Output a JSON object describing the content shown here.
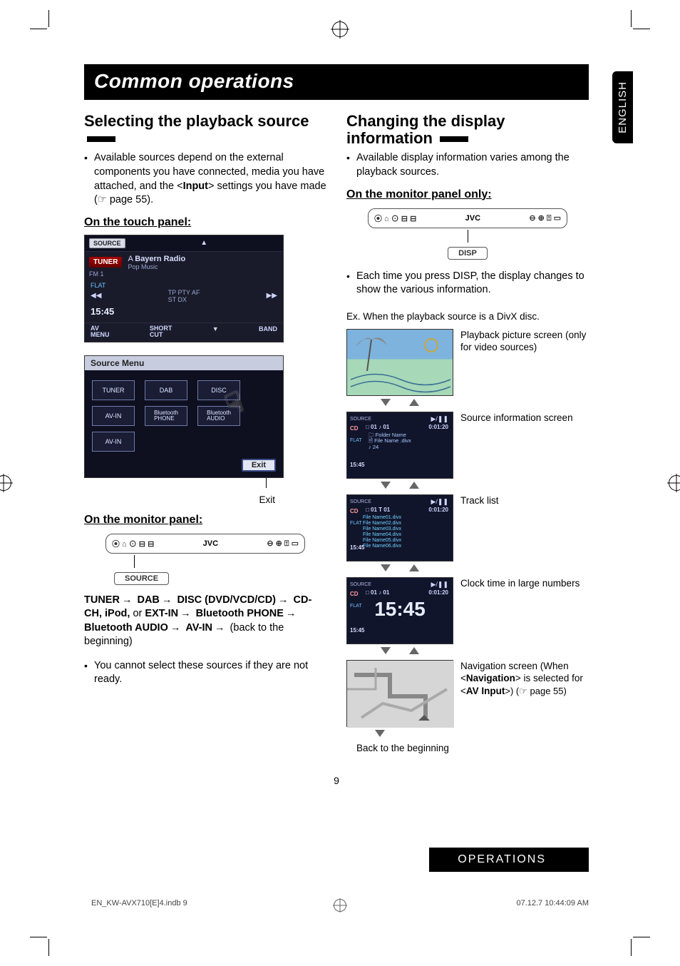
{
  "meta": {
    "language_tab": "ENGLISH",
    "page_number": "9",
    "footer_section": "OPERATIONS",
    "footer_file": "EN_KW-AVX710[E]4.indb   9",
    "footer_timestamp": "07.12.7   10:44:09 AM"
  },
  "title": "Common operations",
  "left": {
    "section_title": "Selecting the playback source",
    "bullet1_pre": "Available sources depend on the external components you have connected, media you have attached, and the <",
    "bullet1_bold": "Input",
    "bullet1_post": "> settings you have made (☞ page 55).",
    "sub_touch": "On the touch panel:",
    "screen": {
      "source_btn": "SOURCE",
      "tuner_badge": "TUNER",
      "fm_label": "FM 1",
      "station_prefix": "A ",
      "station_bold": "Bayern Radio",
      "station_sub": "Pop Music",
      "flat": "FLAT",
      "indicators": "TP PTY AF",
      "stdx": "ST  DX",
      "time": "15:45",
      "av_menu": "AV\nMENU",
      "short": "SHORT\nCUT",
      "band": "BAND",
      "prev_icon": "◀◀",
      "next_icon": "▶▶",
      "up_icon": "▲",
      "down_icon": "▼"
    },
    "source_menu": {
      "header": "Source Menu",
      "items": [
        "TUNER",
        "DAB",
        "DISC",
        "AV-IN",
        "Bluetooth\nPHONE",
        "Bluetooth\nAUDIO",
        "AV-IN"
      ],
      "exit": "Exit",
      "exit_caption": "Exit"
    },
    "sub_monitor": "On the monitor panel:",
    "monitor": {
      "brand": "JVC",
      "source_btn": "SOURCE"
    },
    "flow": {
      "p1": "TUNER",
      "p2": "DAB",
      "p3": "DISC (DVD/VCD/CD)",
      "p4": "CD-CH, iPod,",
      "or": " or ",
      "p5": "EXT-IN",
      "p6": "Bluetooth PHONE",
      "p7": "Bluetooth AUDIO",
      "p8": "AV-IN",
      "tail": " (back to the beginning)"
    },
    "bullet2": "You cannot select these sources if they are not ready."
  },
  "right": {
    "section_title": "Changing the display information",
    "bullet1": "Available display information varies among the playback sources.",
    "sub_monitor_only": "On the monitor panel only:",
    "monitor": {
      "brand": "JVC",
      "disp_btn": "DISP"
    },
    "bullet2": "Each time you press DISP, the display changes to show the various information.",
    "example_caption": "Ex. When the playback source is a DivX disc.",
    "thumbs": {
      "t1_label": "Playback picture screen (only for video sources)",
      "t2_label": "Source information screen",
      "t2": {
        "source": "SOURCE",
        "cd": "CD",
        "nums": "□ 01    ♪ 01",
        "elapsed": "0:01:20",
        "folder_prefix": "🗀",
        "folder": "Folder Name",
        "file_prefix": "🗎",
        "file": "File Name .divx",
        "track": "♪ 24",
        "flat": "FLAT",
        "time": "15:45"
      },
      "t3_label": "Track list",
      "t3": {
        "source": "SOURCE",
        "cd": "CD",
        "nums": "□ 01    T 01",
        "elapsed": "0:01:20",
        "flat": "FLAT",
        "time": "15:45",
        "files": [
          "File Name01.divx",
          "File Name02.divx",
          "File Name03.divx",
          "File Name04.divx",
          "File Name05.divx",
          "File Name06.divx"
        ]
      },
      "t4_label": "Clock time in large numbers",
      "t4": {
        "source": "SOURCE",
        "cd": "CD",
        "nums": "□ 01    ♪ 01",
        "elapsed": "0:01:20",
        "clock": "15:45",
        "flat": "FLAT",
        "time": "15:45"
      },
      "t5_label_pre": "Navigation screen (When <",
      "t5_label_bold1": "Navigation",
      "t5_label_mid": "> is selected for <",
      "t5_label_bold2": "AV Input",
      "t5_label_post": ">) (☞ page 55)"
    },
    "back_caption": "Back to the beginning"
  }
}
